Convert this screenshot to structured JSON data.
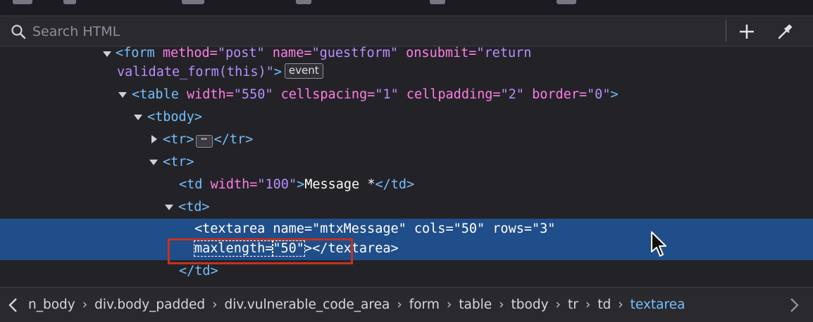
{
  "search": {
    "placeholder": "Search HTML"
  },
  "toolbar": {
    "add_node_icon": "plus-icon",
    "picker_icon": "eyedropper-icon"
  },
  "tree": {
    "form_open": {
      "tag": "<form",
      "attr1_name": "method=",
      "attr1_value": "\"post\"",
      "attr2_name": "name=",
      "attr2_value": "\"guestform\"",
      "attr3_name": "onsubmit=",
      "attr3_value": "\"return"
    },
    "form_wrap": {
      "value": "validate_form(this)\"",
      "close": ">",
      "badge": "event"
    },
    "table_open": {
      "tag": "<table",
      "attr1_name": "width=",
      "attr1_value": "\"550\"",
      "attr2_name": "cellspacing=",
      "attr2_value": "\"1\"",
      "attr3_name": "cellpadding=",
      "attr3_value": "\"2\"",
      "attr4_name": "border=",
      "attr4_value": "\"0\"",
      "close": ">"
    },
    "tbody_open": {
      "text": "<tbody>"
    },
    "tr_collapsed": {
      "open": "<tr>",
      "ellipsis": "⋯",
      "close": "</tr>"
    },
    "tr_open": {
      "text": "<tr>"
    },
    "td_message": {
      "open": "<td",
      "attr_name": "width=",
      "attr_value": "\"100\"",
      "close": ">",
      "text": "Message *",
      "end": "</td>"
    },
    "td_open": {
      "text": "<td>"
    },
    "textarea_line1": {
      "tag": "<textarea",
      "attr1_name": "name=",
      "attr1_value": "\"mtxMessage\"",
      "attr2_name": "cols=",
      "attr2_value": "\"50\"",
      "attr3_name": "rows=",
      "attr3_value": "\"3\""
    },
    "textarea_line2": {
      "attr_name": "maxlength=",
      "attr_value": "\"50\"",
      "close": "></textarea>"
    },
    "td_close": {
      "text": "</td>"
    }
  },
  "breadcrumbs": [
    "n_body",
    "div.body_padded",
    "div.vulnerable_code_area",
    "form",
    "table",
    "tbody",
    "tr",
    "td",
    "textarea"
  ],
  "breadcrumb_separator": "›",
  "colors": {
    "selection": "#204e8a",
    "highlight_box": "#c4321f",
    "tag": "#75bfff",
    "attr_name": "#ff7de9",
    "attr_value": "#b98eff"
  }
}
